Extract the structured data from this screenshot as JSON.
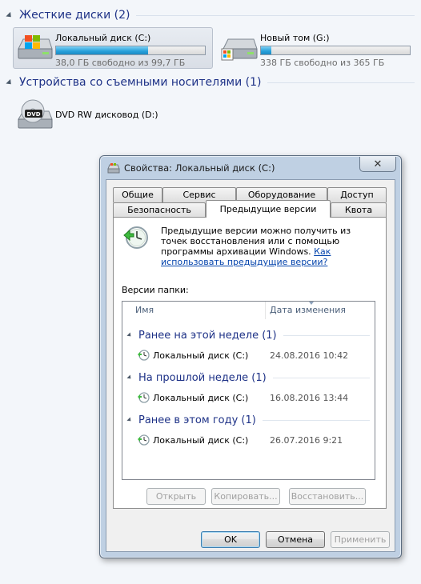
{
  "explorer": {
    "hard_drives_header": "Жесткие диски (2)",
    "drives": [
      {
        "name": "Локальный диск (C:)",
        "free_text": "38,0 ГБ свободно из 99,7 ГБ",
        "used_fraction": 0.62
      },
      {
        "name": "Новый том (G:)",
        "free_text": "338 ГБ свободно из 365 ГБ",
        "used_fraction": 0.07
      }
    ],
    "removable_header": "Устройства со съемными носителями (1)",
    "dvd": {
      "name": "DVD RW дисковод (D:)",
      "icon_label": "DVD"
    }
  },
  "dialog": {
    "title": "Свойства: Локальный диск (C:)",
    "close_glyph": "✕",
    "tabs_row_back": [
      "Общие",
      "Сервис",
      "Оборудование",
      "Доступ"
    ],
    "tabs_row_front": [
      "Безопасность",
      "Предыдущие версии",
      "Квота"
    ],
    "active_tab": "Предыдущие версии",
    "intro_text": "Предыдущие версии можно получить из точек восстановления или с помощью программы архивации Windows.",
    "intro_link": "Как использовать предыдущие версии?",
    "versions_label": "Версии папки:",
    "columns": {
      "name": "Имя",
      "date": "Дата изменения"
    },
    "groups": [
      {
        "title": "Ранее на этой неделе (1)",
        "items": [
          {
            "name": "Локальный диск (C:)",
            "date": "24.08.2016 10:42"
          }
        ]
      },
      {
        "title": "На прошлой неделе (1)",
        "items": [
          {
            "name": "Локальный диск (C:)",
            "date": "16.08.2016 13:44"
          }
        ]
      },
      {
        "title": "Ранее в этом году (1)",
        "items": [
          {
            "name": "Локальный диск (C:)",
            "date": "26.07.2016 9:21"
          }
        ]
      }
    ],
    "action_buttons": {
      "open": "Открыть",
      "copy": "Копировать...",
      "restore": "Восстановить..."
    },
    "footer_buttons": {
      "ok": "OK",
      "cancel": "Отмена",
      "apply": "Применить"
    }
  },
  "colors": {
    "group_header": "#1e3287",
    "accent_bar": "#26a0da",
    "link": "#0645ad"
  }
}
